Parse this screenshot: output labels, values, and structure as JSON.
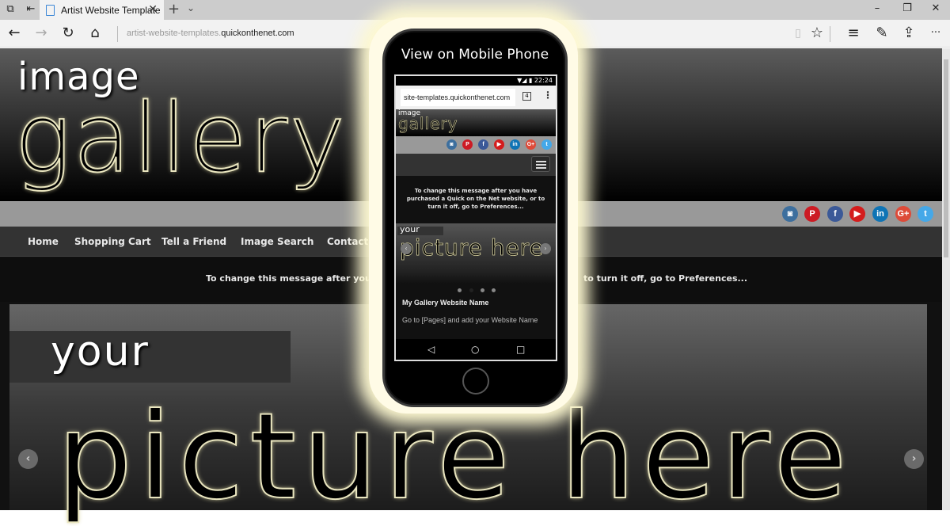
{
  "browser": {
    "tab_title": "Artist Website Template",
    "tab_close": "✕",
    "new_tab": "+",
    "tab_list": "⌄",
    "url_prefix": "artist-website-templates.",
    "url_domain": "quickonthenet.com",
    "window_controls": {
      "minimize": "–",
      "restore": "❐",
      "close": "✕"
    },
    "nav": {
      "back": "←",
      "forward": "→",
      "refresh": "↻",
      "home": "⌂"
    },
    "toolbar": {
      "reading_view": "▯",
      "favorite": "☆",
      "hub": "≡",
      "notes": "✎",
      "share": "⇪",
      "more": "···"
    }
  },
  "site": {
    "logo_top": "image",
    "logo_main": "gallery",
    "social": [
      {
        "name": "instagram",
        "glyph": "◙",
        "color": "#3d6f9e"
      },
      {
        "name": "pinterest",
        "glyph": "P",
        "color": "#cc1b24"
      },
      {
        "name": "facebook",
        "glyph": "f",
        "color": "#3b5998"
      },
      {
        "name": "youtube",
        "glyph": "▶",
        "color": "#d41c1c"
      },
      {
        "name": "linkedin",
        "glyph": "in",
        "color": "#0f74b5"
      },
      {
        "name": "google-plus",
        "glyph": "G+",
        "color": "#dd4b39"
      },
      {
        "name": "twitter",
        "glyph": "t",
        "color": "#45a8e8"
      }
    ],
    "menu": [
      "Home",
      "Shopping Cart",
      "Tell a Friend",
      "Image Search",
      "Contact F"
    ],
    "message_left": "To change this message after you h",
    "message_right": "to turn it off, go to Preferences...",
    "slide_top": "your",
    "slide_main": "picture here",
    "prev": "‹",
    "next": "›"
  },
  "phone": {
    "title": "View on Mobile Phone",
    "time": "▼◢ ▮ 22:24",
    "url": "site-templates.quickonthenet.com",
    "tabs_count": "4",
    "more": "⋮",
    "logo_top": "image",
    "logo_main": "gallery",
    "message": "To change this message after you have purchased a Quick on the Net website, or to turn it off, go to Preferences...",
    "slide_top": "your",
    "slide_main": "picture here",
    "prev": "‹",
    "next": "›",
    "site_name": "My Gallery Website Name",
    "site_hint": "Go to [Pages] and add your Website Name",
    "nav": {
      "back": "◁",
      "home": "○",
      "recent": "□"
    }
  }
}
